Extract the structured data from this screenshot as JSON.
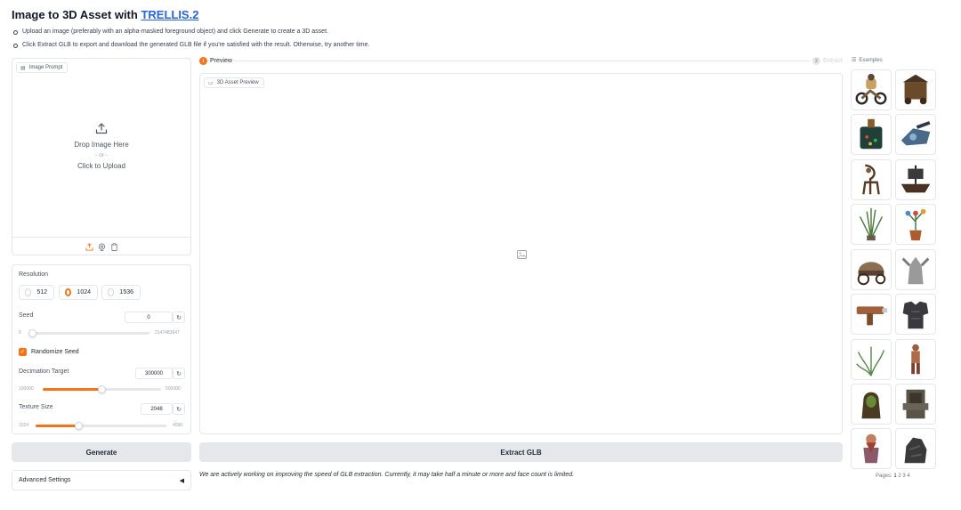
{
  "header": {
    "title_prefix": "Image to 3D Asset with ",
    "title_link": "TRELLIS.2",
    "bullets": [
      "Upload an image (preferably with an alpha-masked foreground object) and click Generate to create a 3D asset.",
      "Click Extract GLB to export and download the generated GLB file if you're satisfied with the result. Otherwise, try another time."
    ]
  },
  "image_prompt": {
    "label": "Image Prompt",
    "drop_text": "Drop Image Here",
    "or_text": "- or -",
    "click_text": "Click to Upload",
    "footer_icons": [
      "upload-icon",
      "webcam-icon",
      "clipboard-icon"
    ]
  },
  "settings": {
    "resolution_label": "Resolution",
    "resolution_options": [
      "512",
      "1024",
      "1536"
    ],
    "resolution_selected": "1024",
    "seed_label": "Seed",
    "seed_value": "0",
    "seed_min": "0",
    "seed_max": "2147483647",
    "seed_level": 0,
    "randomize_label": "Randomize Seed",
    "randomize_checked": true,
    "decimation_label": "Decimation Target",
    "decimation_value": "300000",
    "decimation_min": "100000",
    "decimation_max": "500000",
    "decimation_level": 0.5,
    "texture_label": "Texture Size",
    "texture_value": "2048",
    "texture_min": "1024",
    "texture_max": "4096",
    "texture_level": 0.33
  },
  "buttons": {
    "generate": "Generate",
    "extract": "Extract GLB",
    "advanced": "Advanced Settings"
  },
  "steps": {
    "step1_num": "1",
    "step1_label": "Preview",
    "step2_num": "2",
    "step2_label": "Extract"
  },
  "preview": {
    "label": "3D Asset Preview",
    "note": "We are actively working on improving the speed of GLB extraction. Currently, it may take half a minute or more and face count is limited."
  },
  "examples": {
    "label": "Examples",
    "pages_label": "Pages:",
    "pages": [
      "1",
      "2",
      "3",
      "4"
    ],
    "items": [
      "motorcycle-rider",
      "wooden-cart",
      "potion-bottle",
      "tank",
      "ornate-chair",
      "pirate-ship",
      "grass-plant",
      "flower-pot",
      "wagon",
      "gargoyle",
      "blaster-gun",
      "armor",
      "fern-plant",
      "figure",
      "hooded-figure",
      "throne",
      "dwarf",
      "rock-creature"
    ]
  },
  "colors": {
    "accent": "#f97316",
    "link": "#2563eb",
    "button_bg": "#e5e7eb"
  }
}
